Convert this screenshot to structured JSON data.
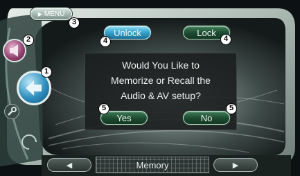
{
  "menu_button": {
    "label": "MENU",
    "callout": "3"
  },
  "side": {
    "source_button_callout": "2",
    "back_button_callout": "1"
  },
  "top_buttons": [
    {
      "label": "Unlock",
      "callout": "4"
    },
    {
      "label": "Lock",
      "callout": "4"
    }
  ],
  "dialog": {
    "message_lines": [
      "Would You Like to",
      "Memorize or Recall the",
      "Audio & AV setup?"
    ],
    "yes_label": "Yes",
    "no_label": "No",
    "yes_callout": "5",
    "no_callout": "5"
  },
  "bottom_bar": {
    "label": "Memory"
  },
  "colors": {
    "accent": "#3aa7cf",
    "panel": "#c9d4cf",
    "button_green": "#2b6b47"
  },
  "icons": [
    "play-icon",
    "source-icon",
    "back-arrow-icon",
    "wrench-icon",
    "left-arrow-icon",
    "right-arrow-icon"
  ]
}
